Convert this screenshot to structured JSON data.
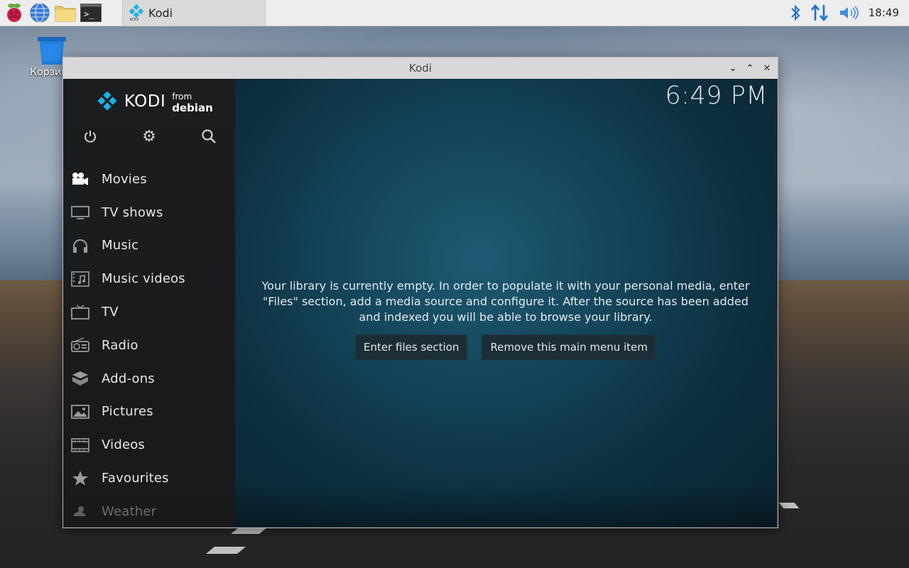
{
  "taskbar": {
    "task_label": "Kodi",
    "clock": "18:49"
  },
  "desktop": {
    "trash_label": "Корзина"
  },
  "window": {
    "title": "Kodi"
  },
  "kodi": {
    "logo_text": "KODI",
    "logo_from": "from",
    "logo_distro": "debian",
    "time": "6:49 PM",
    "menu": [
      {
        "label": "Movies",
        "icon": "movie-camera-icon"
      },
      {
        "label": "TV shows",
        "icon": "monitor-icon"
      },
      {
        "label": "Music",
        "icon": "headphones-icon"
      },
      {
        "label": "Music videos",
        "icon": "music-video-icon"
      },
      {
        "label": "TV",
        "icon": "tv-icon"
      },
      {
        "label": "Radio",
        "icon": "radio-icon"
      },
      {
        "label": "Add-ons",
        "icon": "addon-box-icon"
      },
      {
        "label": "Pictures",
        "icon": "picture-icon"
      },
      {
        "label": "Videos",
        "icon": "film-strip-icon"
      },
      {
        "label": "Favourites",
        "icon": "star-icon"
      },
      {
        "label": "Weather",
        "icon": "weather-icon"
      }
    ],
    "empty_line1": "Your library is currently empty. In order to populate it with your personal media, enter",
    "empty_line2": "\"Files\" section, add a media source and configure it. After the source has been added",
    "empty_line3": "and indexed you will be able to browse your library.",
    "btn_enter": "Enter files section",
    "btn_remove": "Remove this main menu item"
  },
  "colors": {
    "kodi_accent": "#17b2e7",
    "bluetooth": "#1f6fd6"
  }
}
